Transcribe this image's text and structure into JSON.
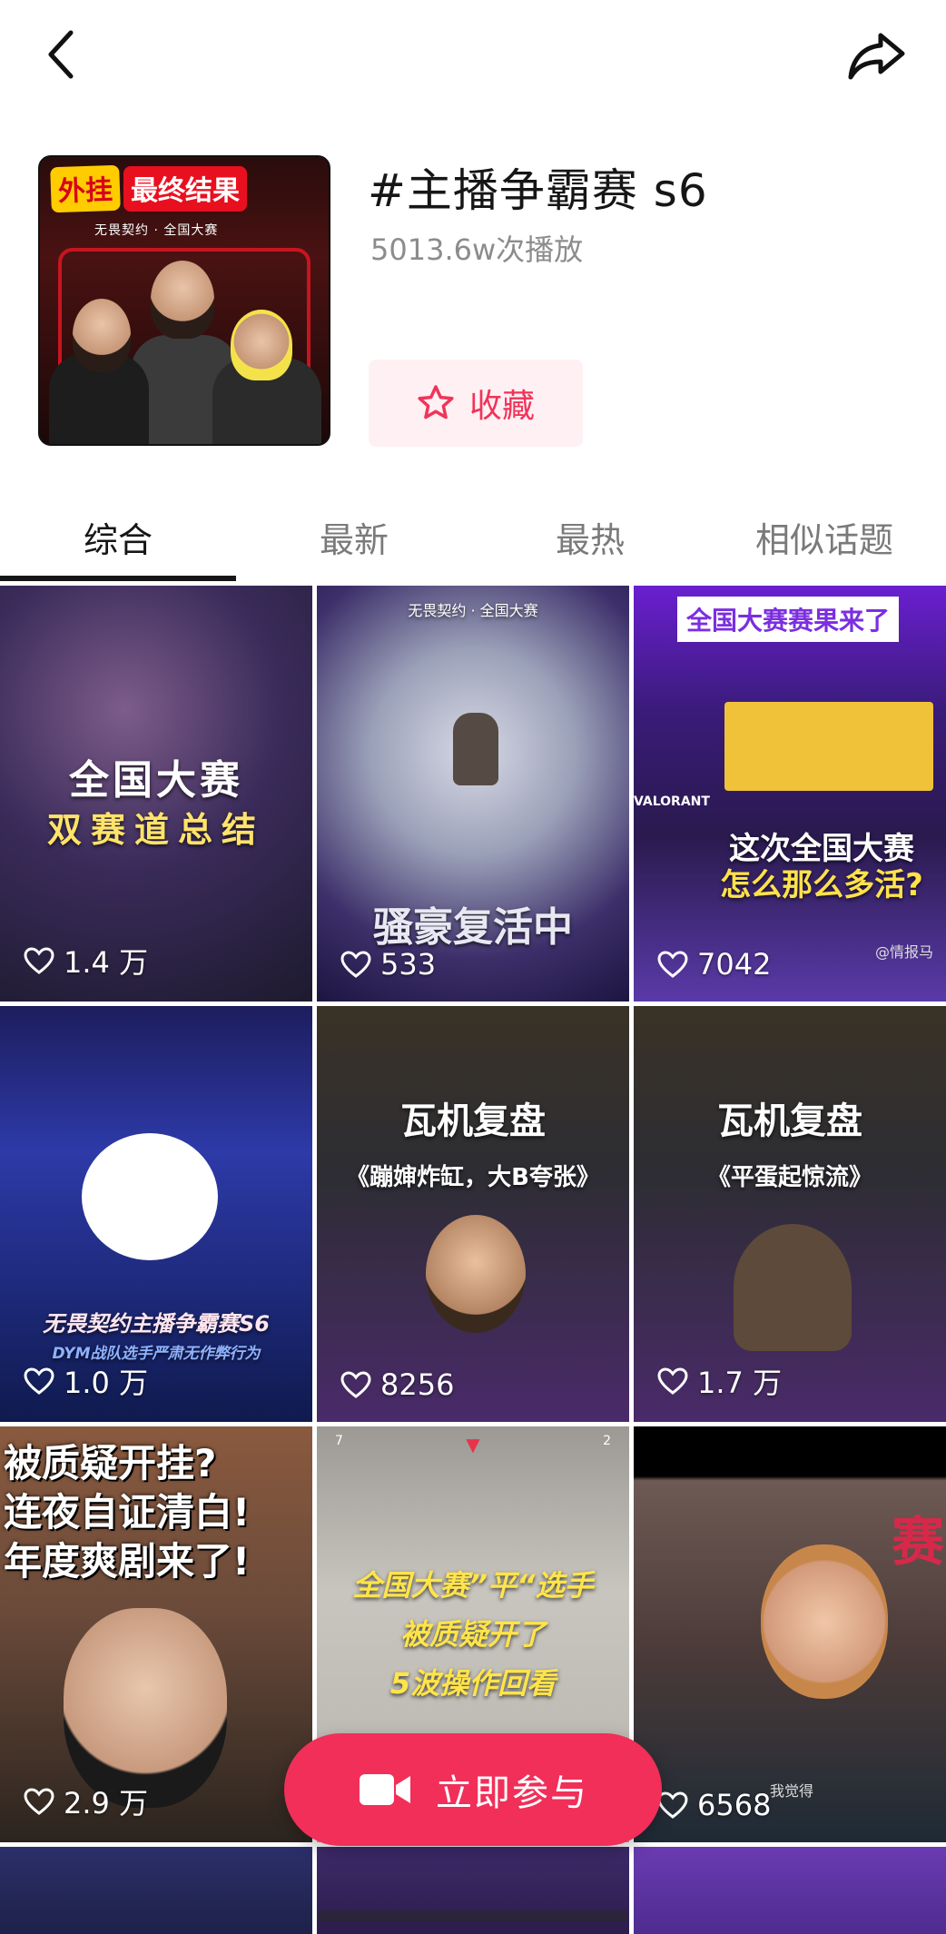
{
  "topic": {
    "title": "#主播争霸赛 s6",
    "plays": "5013.6w次播放",
    "favorite_label": "收藏",
    "cover_banner_left": "外挂",
    "cover_banner_right": "最终结果",
    "cover_logos": "无畏契约 · 全国大赛"
  },
  "tabs": [
    {
      "label": "综合",
      "active": true
    },
    {
      "label": "最新",
      "active": false
    },
    {
      "label": "最热",
      "active": false
    },
    {
      "label": "相似话题",
      "active": false
    }
  ],
  "videos": [
    {
      "likes": "1.4 万",
      "line1": "全国大赛",
      "line2": "双赛道总结"
    },
    {
      "likes": "533",
      "line1": "骚豪复活中",
      "logos": "无畏契约 · 全国大赛"
    },
    {
      "likes": "7042",
      "banner": "全国大赛赛果来了",
      "line1": "这次全国大赛",
      "line2": "怎么那么多活?",
      "tag": "VALORANT",
      "watermark": "@情报马"
    },
    {
      "likes": "1.0 万",
      "line1": "无畏契约主播争霸赛S6",
      "line2": "DYM战队选手严肃无作弊行为"
    },
    {
      "likes": "8256",
      "line1": "瓦机复盘",
      "line2": "《蹦婶炸缸，大B夸张》"
    },
    {
      "likes": "1.7 万",
      "line1": "瓦机复盘",
      "line2": "《平蛋起惊流》"
    },
    {
      "likes": "2.9 万",
      "line1": "被质疑开挂?",
      "line2": "连夜自证清白!",
      "line3": "年度爽剧来了!"
    },
    {
      "likes": "",
      "line1": "全国大赛”平“选手",
      "line2": "被质疑开了",
      "line3": "5波操作回看",
      "hud1": "7",
      "hud2": "2"
    },
    {
      "likes": "6568",
      "side": "赛",
      "watermark": "我觉得"
    }
  ],
  "join_button": {
    "label": "立即参与"
  },
  "colors": {
    "accent": "#f12f59",
    "favorite": "#f0345a",
    "favorite_bg": "#fff0f3"
  }
}
